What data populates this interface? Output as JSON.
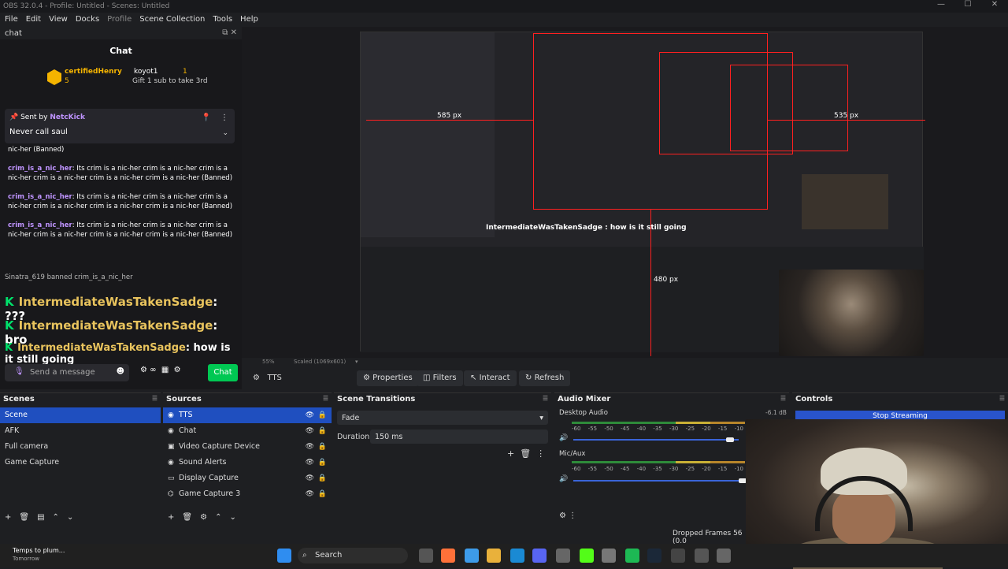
{
  "window": {
    "title": "OBS 32.0.4 - Profile: Untitled - Scenes: Untitled"
  },
  "menu": [
    "File",
    "Edit",
    "View",
    "Docks",
    "Profile",
    "Scene Collection",
    "Tools",
    "Help"
  ],
  "chat": {
    "dock_title": "chat",
    "title": "Chat",
    "leaderboard": {
      "first_name": "certifiedHenry",
      "first_sub": "5",
      "second_name": "koyot1",
      "second_rank": "1",
      "gift_text": "Gift 1 sub to take 3rd"
    },
    "pinned": {
      "sent_by_label": "Sent by",
      "sent_by_user": "NetcKick",
      "message": "Never call saul"
    },
    "truncated_line": "nic-her (Banned)",
    "messages": [
      {
        "user": "crim_is_a_nic_her",
        "text": ": Its crim is a nic-her crim is a nic-her crim is a nic-her crim is a nic-her crim is a nic-her crim is a nic-her (Banned)"
      },
      {
        "user": "crim_is_a_nic_her",
        "text": ": Its crim is a nic-her crim is a nic-her crim is a nic-her crim is a nic-her crim is a nic-her crim is a nic-her (Banned)"
      },
      {
        "user": "crim_is_a_nic_her",
        "text": ": Its crim is a nic-her crim is a nic-her crim is a nic-her crim is a nic-her crim is a nic-her crim is a nic-her (Banned)"
      }
    ],
    "ban_notice": "Sinatra_619 banned crim_is_a_nic_her",
    "big_lines": [
      {
        "badge": "K",
        "user": "IntermediateWasTakenSadge",
        "text": ": ???"
      },
      {
        "badge": "K",
        "user": "IntermediateWasTakenSadge",
        "text": ": bro"
      },
      {
        "badge": "K",
        "user": "IntermediateWasTakenSadge",
        "text": ": how is it still going"
      }
    ],
    "small_overlaps": [
      "IntermediateWasTakenSadge: ???",
      "IntermediateWasTakenSadge: bro"
    ],
    "input_placeholder": "Send a message",
    "send_label": "Chat"
  },
  "preview": {
    "label_585": "585 px",
    "label_535": "535 px",
    "label_480": "480 px",
    "nested_chat_line": "IntermediateWasTakenSadge : how is it still going",
    "zoom_text": "55%",
    "scaled_text": "Scaled (1069x601)"
  },
  "toolbar": {
    "source_name": "TTS",
    "properties": "Properties",
    "filters": "Filters",
    "interact": "Interact",
    "refresh": "Refresh"
  },
  "scenes": {
    "title": "Scenes",
    "items": [
      "Scene",
      "AFK",
      "Full camera",
      "Game Capture"
    ]
  },
  "sources": {
    "title": "Sources",
    "items": [
      "TTS",
      "Chat",
      "Video Capture Device",
      "Sound Alerts",
      "Display Capture",
      "Game Capture 3"
    ]
  },
  "transitions": {
    "title": "Scene Transitions",
    "type": "Fade",
    "duration_label": "Duration",
    "duration_value": "150 ms"
  },
  "mixer": {
    "title": "Audio Mixer",
    "ch1_name": "Desktop Audio",
    "ch1_db": "-6.1 dB",
    "ch2_name": "Mic/Aux",
    "scale": "-60 -55 -50 -45 -40 -35 -30 -25 -20 -15 -10 -5"
  },
  "controls": {
    "title": "Controls",
    "stop_streaming": "Stop Streaming"
  },
  "status": {
    "dropped": "Dropped Frames 56 (0.0"
  },
  "taskbar": {
    "weather_line1": "Temps to plum...",
    "weather_line2": "Tomorrow",
    "search": "Search"
  },
  "colors": {
    "accent_blue": "#1f4fbf",
    "twitch_purple": "#bf94ff",
    "kick_green": "#00e16b",
    "chat_green": "#00c853",
    "guide_red": "#ff2020"
  }
}
